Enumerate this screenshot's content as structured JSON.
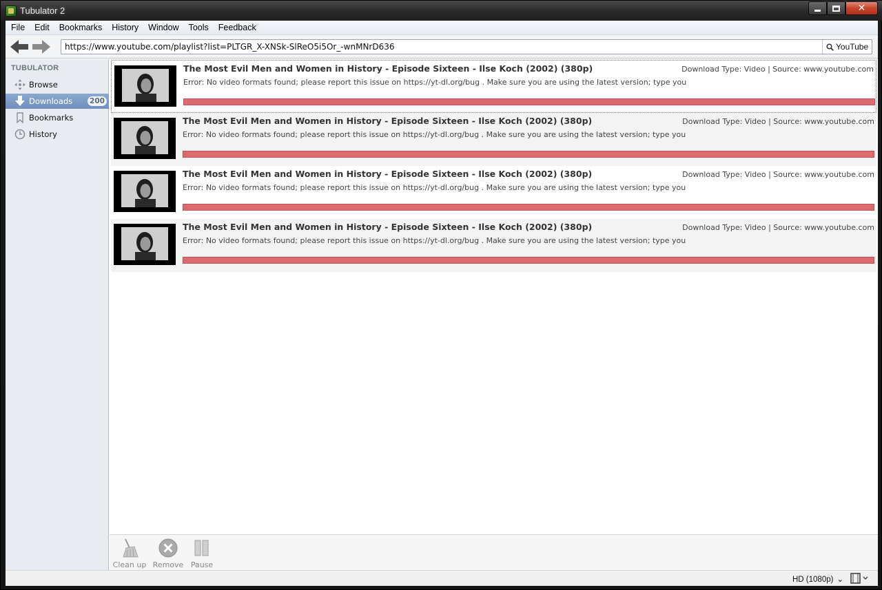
{
  "window": {
    "title": "Tubulator 2"
  },
  "menu": [
    "File",
    "Edit",
    "Bookmarks",
    "History",
    "Window",
    "Tools",
    "Feedback"
  ],
  "toolbar": {
    "url": "https://www.youtube.com/playlist?list=PLTGR_X-XNSk-SlReO5i5Or_-wnMNrD636",
    "search_engine": "YouTube"
  },
  "sidebar": {
    "heading": "TUBULATOR",
    "items": [
      {
        "label": "Browse",
        "icon": "browse-icon",
        "active": false
      },
      {
        "label": "Downloads",
        "icon": "download-icon",
        "active": true,
        "badge": "200"
      },
      {
        "label": "Bookmarks",
        "icon": "bookmark-icon",
        "active": false
      },
      {
        "label": "History",
        "icon": "clock-icon",
        "active": false
      }
    ]
  },
  "downloads": [
    {
      "title": "The Most Evil Men and Women in History - Episode Sixteen - Ilse Koch (2002) (380p)",
      "meta": "Download Type: Video | Source: www.youtube.com",
      "error": "Error: No video formats found; please report this issue on https://yt-dl.org/bug . Make sure you are using the latest version; type  you",
      "progress": 1.0,
      "selected": true
    },
    {
      "title": "The Most Evil Men and Women in History - Episode Sixteen - Ilse Koch (2002) (380p)",
      "meta": "Download Type: Video | Source: www.youtube.com",
      "error": "Error: No video formats found; please report this issue on https://yt-dl.org/bug . Make sure you are using the latest version; type  you",
      "progress": 1.0,
      "selected": false
    },
    {
      "title": "The Most Evil Men and Women in History - Episode Sixteen - Ilse Koch (2002) (380p)",
      "meta": "Download Type: Video | Source: www.youtube.com",
      "error": "Error: No video formats found; please report this issue on https://yt-dl.org/bug . Make sure you are using the latest version; type  you",
      "progress": 1.0,
      "selected": false
    },
    {
      "title": "The Most Evil Men and Women in History - Episode Sixteen - Ilse Koch (2002) (380p)",
      "meta": "Download Type: Video | Source: www.youtube.com",
      "error": "Error: No video formats found; please report this issue on https://yt-dl.org/bug . Make sure you are using the latest version; type  you",
      "progress": 1.0,
      "selected": false
    }
  ],
  "actions": [
    {
      "label": "Clean up",
      "icon": "broom-icon"
    },
    {
      "label": "Remove",
      "icon": "remove-icon"
    },
    {
      "label": "Pause",
      "icon": "pause-icon"
    }
  ],
  "statusbar": {
    "quality": "HD (1080p)"
  },
  "colors": {
    "progress_error": "#d9666a",
    "sidebar_active": "#7b9bc6",
    "sidebar_bg": "#e8ecf1"
  }
}
